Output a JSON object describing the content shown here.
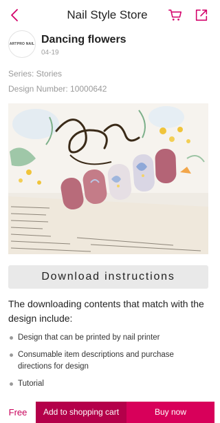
{
  "header": {
    "title": "Nail Style Store",
    "back_icon": "chevron-left-icon",
    "cart_icon": "cart-icon",
    "share_icon": "share-icon"
  },
  "author": {
    "logo_text": "ARTPRO NAIL",
    "design_name": "Dancing flowers",
    "date": "04-19"
  },
  "details": {
    "series": "Series: Stories",
    "design_number": "Design Number: 10000642"
  },
  "colors": {
    "accent": "#c8005a",
    "cart_button": "#b4004a",
    "buy_button": "#d8005a",
    "download_button_bg": "#e9e9e9"
  },
  "download_button": "Download instructions",
  "contents": {
    "intro": "The downloading contents that match with the design include:",
    "items": [
      "Design that can be printed by nail printer",
      "Consumable item descriptions and purchase directions for design",
      "Tutorial"
    ]
  },
  "bottom": {
    "price": "Free",
    "add_to_cart": "Add to shopping cart",
    "buy_now": "Buy now"
  }
}
